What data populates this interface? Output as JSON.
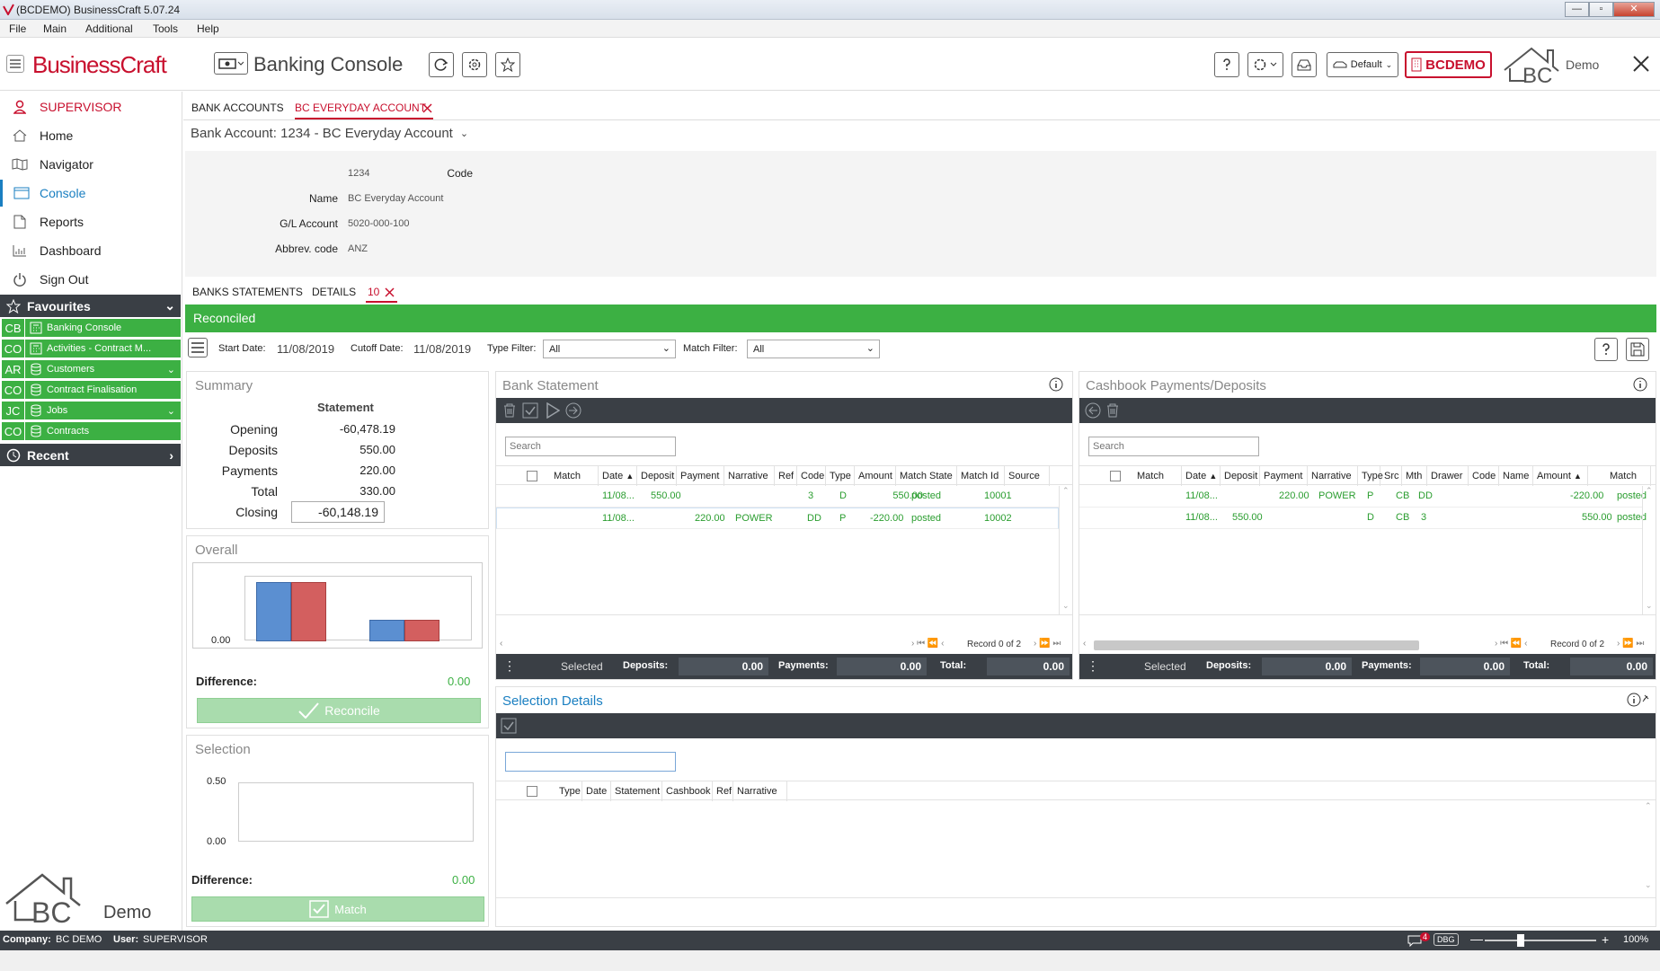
{
  "window": {
    "title": "(BCDEMO) BusinessCraft  5.07.24"
  },
  "menu": [
    "File",
    "Main",
    "Additional",
    "Tools",
    "Help"
  ],
  "header": {
    "brand": "BusinessCraft",
    "page_title": "Banking Console",
    "profile": "Default",
    "company_badge": "BCDEMO",
    "logo_text": "Demo"
  },
  "sidebar": {
    "user": "SUPERVISOR",
    "items": [
      "Home",
      "Navigator",
      "Console",
      "Reports",
      "Dashboard",
      "Sign Out"
    ],
    "active": "Console",
    "favourites_label": "Favourites",
    "favourites": [
      {
        "code": "CB",
        "label": "Banking Console",
        "icon": "calculator-icon"
      },
      {
        "code": "CO",
        "label": "Activities - Contract M...",
        "icon": "calculator-icon"
      },
      {
        "code": "AR",
        "label": "Customers",
        "icon": "database-icon"
      },
      {
        "code": "CO",
        "label": "Contract Finalisation",
        "icon": "database-icon"
      },
      {
        "code": "JC",
        "label": "Jobs",
        "icon": "database-icon"
      },
      {
        "code": "CO",
        "label": "Contracts",
        "icon": "database-icon"
      }
    ],
    "recent_label": "Recent",
    "logo_text": "Demo"
  },
  "tabs": {
    "top": [
      "BANK ACCOUNTS",
      "BC EVERYDAY ACCOUNT"
    ],
    "sub": [
      "BANKS STATEMENTS",
      "DETAILS",
      "10"
    ]
  },
  "account": {
    "selector": "Bank Account: 1234 - BC Everyday Account",
    "fields": [
      {
        "label": "Code",
        "value": "1234"
      },
      {
        "label": "Name",
        "value": "BC Everyday Account"
      },
      {
        "label": "G/L Account",
        "value": "5020-000-100"
      },
      {
        "label": "Abbrev. code",
        "value": "ANZ"
      }
    ]
  },
  "status_banner": "Reconciled",
  "filters": {
    "start_label": "Start Date:",
    "start": "11/08/2019",
    "cutoff_label": "Cutoff Date:",
    "cutoff": "11/08/2019",
    "type_label": "Type Filter:",
    "type": "All",
    "match_label": "Match Filter:",
    "match": "All"
  },
  "summary": {
    "title": "Summary",
    "column": "Statement",
    "rows": [
      {
        "label": "Opening",
        "value": "-60,478.19"
      },
      {
        "label": "Deposits",
        "value": "550.00"
      },
      {
        "label": "Payments",
        "value": "220.00"
      },
      {
        "label": "Total",
        "value": "330.00"
      },
      {
        "label": "Closing",
        "value": "-60,148.19"
      }
    ]
  },
  "overall": {
    "title": "Overall",
    "axis_label": "0.00",
    "difference_label": "Difference:",
    "difference": "0.00",
    "button": "Reconcile"
  },
  "selection": {
    "title": "Selection",
    "axis_top": "0.50",
    "axis_bottom": "0.00",
    "difference_label": "Difference:",
    "difference": "0.00",
    "button": "Match"
  },
  "bank_statement": {
    "title": "Bank Statement",
    "search_placeholder": "Search",
    "columns": [
      "Match",
      "Date",
      "Deposit",
      "Payment",
      "Narrative",
      "Ref",
      "Code",
      "Type",
      "Amount",
      "Match State",
      "Match Id",
      "Source"
    ],
    "rows": [
      {
        "date": "11/08...",
        "deposit": "550.00",
        "payment": "",
        "narrative": "",
        "ref": "",
        "code": "3",
        "type": "D",
        "amount": "550.00",
        "state": "posted",
        "id": "10001"
      },
      {
        "date": "11/08...",
        "deposit": "",
        "payment": "220.00",
        "narrative": "POWER",
        "ref": "",
        "code": "DD",
        "type": "P",
        "amount": "-220.00",
        "state": "posted",
        "id": "10002"
      }
    ],
    "record": "Record 0 of 2",
    "footer": {
      "selected": "Selected",
      "deposits_label": "Deposits:",
      "deposits": "0.00",
      "payments_label": "Payments:",
      "payments": "0.00",
      "total_label": "Total:",
      "total": "0.00"
    }
  },
  "cashbook": {
    "title": "Cashbook Payments/Deposits",
    "search_placeholder": "Search",
    "columns": [
      "Match",
      "Date",
      "Deposit",
      "Payment",
      "Narrative",
      "Type",
      "Src",
      "Mth",
      "Drawer",
      "Code",
      "Name",
      "Amount",
      "Match"
    ],
    "rows": [
      {
        "date": "11/08...",
        "deposit": "",
        "payment": "220.00",
        "narrative": "POWER",
        "type": "P",
        "src": "CB",
        "mth": "DD",
        "amount": "-220.00",
        "state": "posted"
      },
      {
        "date": "11/08...",
        "deposit": "550.00",
        "payment": "",
        "narrative": "",
        "type": "D",
        "src": "CB",
        "mth": "3",
        "amount": "550.00",
        "state": "posted"
      }
    ],
    "record": "Record 0 of 2",
    "footer": {
      "selected": "Selected",
      "deposits_label": "Deposits:",
      "deposits": "0.00",
      "payments_label": "Payments:",
      "payments": "0.00",
      "total_label": "Total:",
      "total": "0.00"
    }
  },
  "selection_details": {
    "title": "Selection Details",
    "columns": [
      "Type",
      "Date",
      "Statement",
      "Cashbook",
      "Ref",
      "Narrative"
    ]
  },
  "status": {
    "company_label": "Company:",
    "company": "BC DEMO",
    "user_label": "User:",
    "user": "SUPERVISOR",
    "badge_count": "4",
    "dbg": "DBG",
    "zoom": "100%"
  },
  "colors": {
    "accent_green": "#3cb043",
    "brand_red": "#c8102e",
    "dark": "#3a3f45",
    "link_blue": "#1a7fc1"
  }
}
